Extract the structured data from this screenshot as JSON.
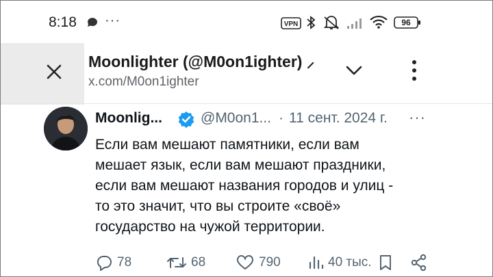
{
  "status_bar": {
    "time": "8:18",
    "vpn_badge": "VPN",
    "battery": "96",
    "icons": [
      "chat-bubble-icon",
      "more-dots-icon",
      "vpn-icon",
      "bluetooth-icon",
      "mute-icon",
      "signal-icon",
      "wifi-icon",
      "battery-icon"
    ],
    "dots": "···"
  },
  "browser": {
    "page_title": "Moonlighter (@M0on1ighter) ⸝",
    "url": "x.com/M0on1ighter",
    "close_icon": "close-icon",
    "expand_icon": "chevron-down-icon",
    "menu_icon": "kebab-menu-icon"
  },
  "tweet": {
    "author": "Moonlig...",
    "handle": "@M0on1...",
    "separator": "·",
    "date": "11 сент. 2024 г.",
    "more": "···",
    "text_lines": [
      "Если вам мешают памятники, если вам",
      "мешает язык, если вам мешают праздники,",
      "если вам мешают названия городов и улиц -",
      "то это значит, что вы строите «своё»",
      "государство на чужой территории."
    ],
    "actions": {
      "replies": "78",
      "reposts": "68",
      "likes": "790",
      "views": "40 тыс."
    }
  },
  "colors": {
    "verified": "#1d9bf0",
    "muted_text": "#536471",
    "text": "#0f1419"
  }
}
